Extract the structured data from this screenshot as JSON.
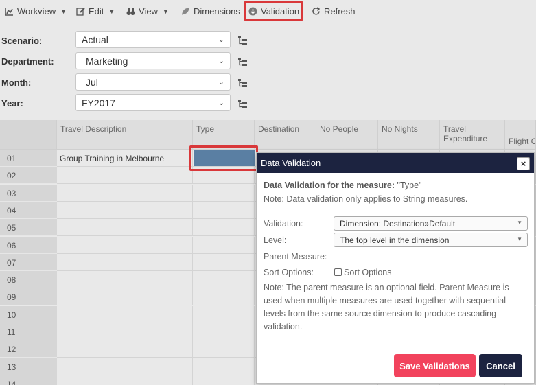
{
  "toolbar": {
    "workview": "Workview",
    "edit": "Edit",
    "view": "View",
    "dimensions": "Dimensions",
    "validation": "Validation",
    "refresh": "Refresh"
  },
  "filters": {
    "scenario": {
      "label": "Scenario:",
      "value": "Actual"
    },
    "department": {
      "label": "Department:",
      "value": "Marketing"
    },
    "month": {
      "label": "Month:",
      "value": "Jul"
    },
    "year": {
      "label": "Year:",
      "value": "FY2017"
    }
  },
  "grid": {
    "columns": [
      "Travel Description",
      "Type",
      "Destination",
      "No People",
      "No Nights",
      "Travel Expenditure",
      "Flight Co"
    ],
    "rows": [
      "01",
      "02",
      "03",
      "04",
      "05",
      "06",
      "07",
      "08",
      "09",
      "10",
      "11",
      "12",
      "13",
      "14"
    ],
    "row1_description": "Group Training in Melbourne"
  },
  "dialog": {
    "title": "Data Validation",
    "close": "×",
    "heading_bold": "Data Validation for the measure:",
    "heading_measure": " \"Type\"",
    "note1": "Note: Data validation only applies to String measures.",
    "validation_label": "Validation:",
    "validation_value": "Dimension: Destination»Default",
    "level_label": "Level:",
    "level_value": "The top level in the dimension",
    "parent_label": "Parent Measure:",
    "parent_value": "",
    "sort_label": "Sort Options:",
    "sort_checkbox_label": "Sort Options",
    "note2": "Note: The parent measure is an optional field. Parent Measure is used when multiple measures are used together with sequential levels from the same source dimension to produce cascading validation.",
    "save": "Save Validations",
    "cancel": "Cancel"
  },
  "colors": {
    "dialog_header": "#1c2340",
    "save_button": "#f2435d",
    "highlight": "#d9383a",
    "selected_cell": "#5a7fa3"
  }
}
